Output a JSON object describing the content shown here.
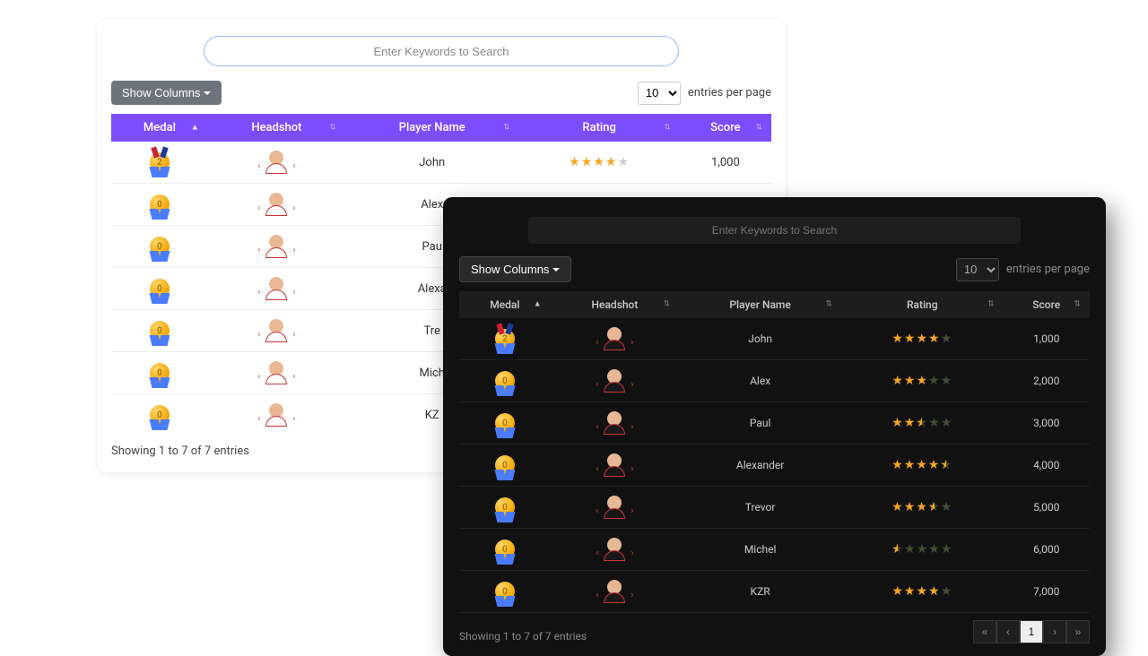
{
  "search": {
    "placeholder": "Enter Keywords to Search"
  },
  "show_columns_label": "Show Columns",
  "entries": {
    "value": "10",
    "label": "entries per page"
  },
  "columns": [
    "Medal",
    "Headshot",
    "Player Name",
    "Rating",
    "Score"
  ],
  "rows": [
    {
      "medal": "striped",
      "name": "John",
      "rating": 4.0,
      "score": "1,000"
    },
    {
      "medal": "ribbon",
      "name": "Alex",
      "rating": 3.0,
      "score": "2,000"
    },
    {
      "medal": "ribbon",
      "name": "Paul",
      "rating": 2.5,
      "score": "3,000"
    },
    {
      "medal": "ribbon",
      "name": "Alexander",
      "rating": 4.5,
      "score": "4,000"
    },
    {
      "medal": "ribbon",
      "name": "Trevor",
      "rating": 3.5,
      "score": "5,000"
    },
    {
      "medal": "ribbon",
      "name": "Michel",
      "rating": 0.5,
      "score": "6,000"
    },
    {
      "medal": "ribbon",
      "name": "KZR",
      "rating": 4.0,
      "score": "7,000"
    }
  ],
  "showing": "Showing 1 to 7 of 7 entries",
  "pager": {
    "first": "«",
    "prev": "‹",
    "current": "1",
    "next": "›",
    "last": "»"
  },
  "light_rows_visible": [
    "John",
    "Alex",
    "Paul",
    "Alexander",
    "Trevor",
    "Michel",
    "KZR"
  ],
  "light_name_clip": {
    "Paul": "Pau",
    "Alexander": "Alexa",
    "Trevor": "Tre",
    "Michel": "Mich",
    "KZR": "KZ"
  }
}
